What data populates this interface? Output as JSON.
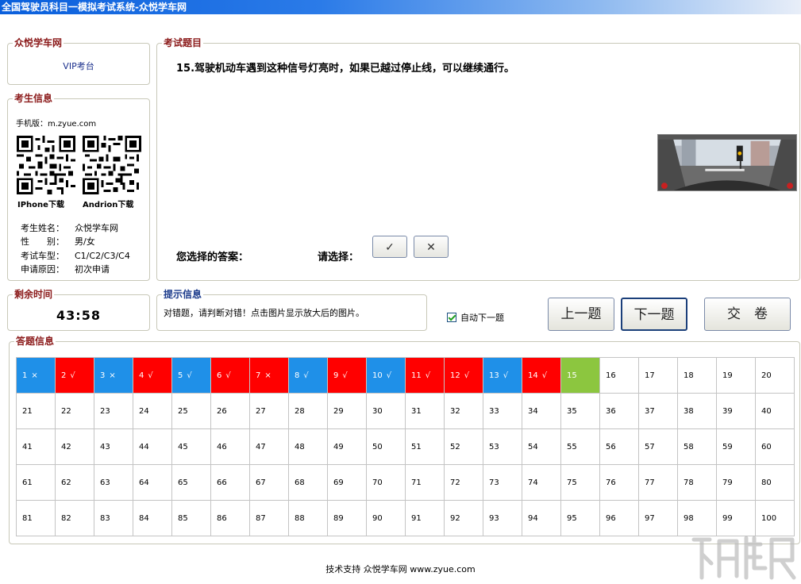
{
  "window": {
    "title": "全国驾驶员科目一模拟考试系统-众悦学车网"
  },
  "brand": {
    "group_title": "众悦学车网",
    "vip": "VIP考台"
  },
  "candidate": {
    "group_title": "考生信息",
    "mobile": "手机版：m.zyue.com",
    "iphone_caption": "IPhone下载",
    "android_caption": "Andrion下载",
    "rows": [
      {
        "key": "考生姓名：",
        "value": "众悦学车网"
      },
      {
        "key": "性　　别：",
        "value": "男/女"
      },
      {
        "key": "考试车型：",
        "value": "C1/C2/C3/C4"
      },
      {
        "key": "申请原因：",
        "value": "初次申请"
      }
    ]
  },
  "question": {
    "group_title": "考试题目",
    "text": "15.驾驶机动车遇到这种信号灯亮时，如果已越过停止线，可以继续通行。",
    "your_answer_label": "您选择的答案：",
    "choose_label": "请选择：",
    "btn_correct": "✓",
    "btn_wrong": "✕"
  },
  "timer": {
    "group_title": "剩余时间",
    "value": "43:58"
  },
  "hint": {
    "group_title": "提示信息",
    "text": "对错题，请判断对错！点击图片显示放大后的图片。"
  },
  "controls": {
    "auto_next": "自动下一题",
    "auto_next_checked": true,
    "prev": "上一题",
    "next": "下一题",
    "submit": "交　卷"
  },
  "answers": {
    "group_title": "答题信息",
    "cells": [
      {
        "n": "1",
        "mark": "×",
        "state": "blue"
      },
      {
        "n": "2",
        "mark": "√",
        "state": "red"
      },
      {
        "n": "3",
        "mark": "×",
        "state": "blue"
      },
      {
        "n": "4",
        "mark": "√",
        "state": "red"
      },
      {
        "n": "5",
        "mark": "√",
        "state": "blue"
      },
      {
        "n": "6",
        "mark": "√",
        "state": "red"
      },
      {
        "n": "7",
        "mark": "×",
        "state": "red"
      },
      {
        "n": "8",
        "mark": "√",
        "state": "blue"
      },
      {
        "n": "9",
        "mark": "√",
        "state": "red"
      },
      {
        "n": "10",
        "mark": "√",
        "state": "blue"
      },
      {
        "n": "11",
        "mark": "√",
        "state": "red"
      },
      {
        "n": "12",
        "mark": "√",
        "state": "red"
      },
      {
        "n": "13",
        "mark": "√",
        "state": "blue"
      },
      {
        "n": "14",
        "mark": "√",
        "state": "red"
      },
      {
        "n": "15",
        "mark": "",
        "state": "green"
      },
      {
        "n": "16",
        "mark": "",
        "state": "none"
      },
      {
        "n": "17",
        "mark": "",
        "state": "none"
      },
      {
        "n": "18",
        "mark": "",
        "state": "none"
      },
      {
        "n": "19",
        "mark": "",
        "state": "none"
      },
      {
        "n": "20",
        "mark": "",
        "state": "none"
      },
      {
        "n": "21",
        "mark": "",
        "state": "none"
      },
      {
        "n": "22",
        "mark": "",
        "state": "none"
      },
      {
        "n": "23",
        "mark": "",
        "state": "none"
      },
      {
        "n": "24",
        "mark": "",
        "state": "none"
      },
      {
        "n": "25",
        "mark": "",
        "state": "none"
      },
      {
        "n": "26",
        "mark": "",
        "state": "none"
      },
      {
        "n": "27",
        "mark": "",
        "state": "none"
      },
      {
        "n": "28",
        "mark": "",
        "state": "none"
      },
      {
        "n": "29",
        "mark": "",
        "state": "none"
      },
      {
        "n": "30",
        "mark": "",
        "state": "none"
      },
      {
        "n": "31",
        "mark": "",
        "state": "none"
      },
      {
        "n": "32",
        "mark": "",
        "state": "none"
      },
      {
        "n": "33",
        "mark": "",
        "state": "none"
      },
      {
        "n": "34",
        "mark": "",
        "state": "none"
      },
      {
        "n": "35",
        "mark": "",
        "state": "none"
      },
      {
        "n": "36",
        "mark": "",
        "state": "none"
      },
      {
        "n": "37",
        "mark": "",
        "state": "none"
      },
      {
        "n": "38",
        "mark": "",
        "state": "none"
      },
      {
        "n": "39",
        "mark": "",
        "state": "none"
      },
      {
        "n": "40",
        "mark": "",
        "state": "none"
      },
      {
        "n": "41",
        "mark": "",
        "state": "none"
      },
      {
        "n": "42",
        "mark": "",
        "state": "none"
      },
      {
        "n": "43",
        "mark": "",
        "state": "none"
      },
      {
        "n": "44",
        "mark": "",
        "state": "none"
      },
      {
        "n": "45",
        "mark": "",
        "state": "none"
      },
      {
        "n": "46",
        "mark": "",
        "state": "none"
      },
      {
        "n": "47",
        "mark": "",
        "state": "none"
      },
      {
        "n": "48",
        "mark": "",
        "state": "none"
      },
      {
        "n": "49",
        "mark": "",
        "state": "none"
      },
      {
        "n": "50",
        "mark": "",
        "state": "none"
      },
      {
        "n": "51",
        "mark": "",
        "state": "none"
      },
      {
        "n": "52",
        "mark": "",
        "state": "none"
      },
      {
        "n": "53",
        "mark": "",
        "state": "none"
      },
      {
        "n": "54",
        "mark": "",
        "state": "none"
      },
      {
        "n": "55",
        "mark": "",
        "state": "none"
      },
      {
        "n": "56",
        "mark": "",
        "state": "none"
      },
      {
        "n": "57",
        "mark": "",
        "state": "none"
      },
      {
        "n": "58",
        "mark": "",
        "state": "none"
      },
      {
        "n": "59",
        "mark": "",
        "state": "none"
      },
      {
        "n": "60",
        "mark": "",
        "state": "none"
      },
      {
        "n": "61",
        "mark": "",
        "state": "none"
      },
      {
        "n": "62",
        "mark": "",
        "state": "none"
      },
      {
        "n": "63",
        "mark": "",
        "state": "none"
      },
      {
        "n": "64",
        "mark": "",
        "state": "none"
      },
      {
        "n": "65",
        "mark": "",
        "state": "none"
      },
      {
        "n": "66",
        "mark": "",
        "state": "none"
      },
      {
        "n": "67",
        "mark": "",
        "state": "none"
      },
      {
        "n": "68",
        "mark": "",
        "state": "none"
      },
      {
        "n": "69",
        "mark": "",
        "state": "none"
      },
      {
        "n": "70",
        "mark": "",
        "state": "none"
      },
      {
        "n": "71",
        "mark": "",
        "state": "none"
      },
      {
        "n": "72",
        "mark": "",
        "state": "none"
      },
      {
        "n": "73",
        "mark": "",
        "state": "none"
      },
      {
        "n": "74",
        "mark": "",
        "state": "none"
      },
      {
        "n": "75",
        "mark": "",
        "state": "none"
      },
      {
        "n": "76",
        "mark": "",
        "state": "none"
      },
      {
        "n": "77",
        "mark": "",
        "state": "none"
      },
      {
        "n": "78",
        "mark": "",
        "state": "none"
      },
      {
        "n": "79",
        "mark": "",
        "state": "none"
      },
      {
        "n": "80",
        "mark": "",
        "state": "none"
      },
      {
        "n": "81",
        "mark": "",
        "state": "none"
      },
      {
        "n": "82",
        "mark": "",
        "state": "none"
      },
      {
        "n": "83",
        "mark": "",
        "state": "none"
      },
      {
        "n": "84",
        "mark": "",
        "state": "none"
      },
      {
        "n": "85",
        "mark": "",
        "state": "none"
      },
      {
        "n": "86",
        "mark": "",
        "state": "none"
      },
      {
        "n": "87",
        "mark": "",
        "state": "none"
      },
      {
        "n": "88",
        "mark": "",
        "state": "none"
      },
      {
        "n": "89",
        "mark": "",
        "state": "none"
      },
      {
        "n": "90",
        "mark": "",
        "state": "none"
      },
      {
        "n": "91",
        "mark": "",
        "state": "none"
      },
      {
        "n": "92",
        "mark": "",
        "state": "none"
      },
      {
        "n": "93",
        "mark": "",
        "state": "none"
      },
      {
        "n": "94",
        "mark": "",
        "state": "none"
      },
      {
        "n": "95",
        "mark": "",
        "state": "none"
      },
      {
        "n": "96",
        "mark": "",
        "state": "none"
      },
      {
        "n": "97",
        "mark": "",
        "state": "none"
      },
      {
        "n": "98",
        "mark": "",
        "state": "none"
      },
      {
        "n": "99",
        "mark": "",
        "state": "none"
      },
      {
        "n": "100",
        "mark": "",
        "state": "none"
      }
    ],
    "colors": {
      "blue": "#1f90e8",
      "red": "#ff0000",
      "green": "#8cc63f"
    }
  },
  "footer": {
    "text": "技术支持 众悦学车网 www.zyue.com"
  }
}
